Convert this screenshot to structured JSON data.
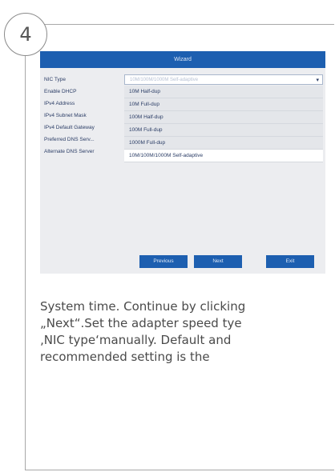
{
  "step": {
    "number": "4"
  },
  "wizard": {
    "title": "Wizard",
    "fields": [
      "NIC Type",
      "Enable DHCP",
      "IPv4 Address",
      "IPv4 Subnet Mask",
      "IPv4 Default Gateway",
      "Preferred DNS Serv...",
      "Alternate DNS Server"
    ],
    "nic_type_value": "10M/100M/1000M Self-adaptive",
    "nic_options": [
      "10M Half-dup",
      "10M Full-dup",
      "100M Half-dup",
      "100M Full-dup",
      "1000M Full-dup",
      "10M/100M/1000M Self-adaptive"
    ],
    "buttons": {
      "previous": "Previous",
      "next": "Next",
      "exit": "Exit"
    }
  },
  "caption": {
    "lines": [
      "System time. Continue by clicking",
      "„Next“.Set the adapter speed tye",
      "‚NIC type‘manually. Default and",
      "recommended setting is the"
    ]
  },
  "colors": {
    "accent": "#1d5fb0",
    "border": "#a8a8a8",
    "text": "#4a4a4a"
  }
}
